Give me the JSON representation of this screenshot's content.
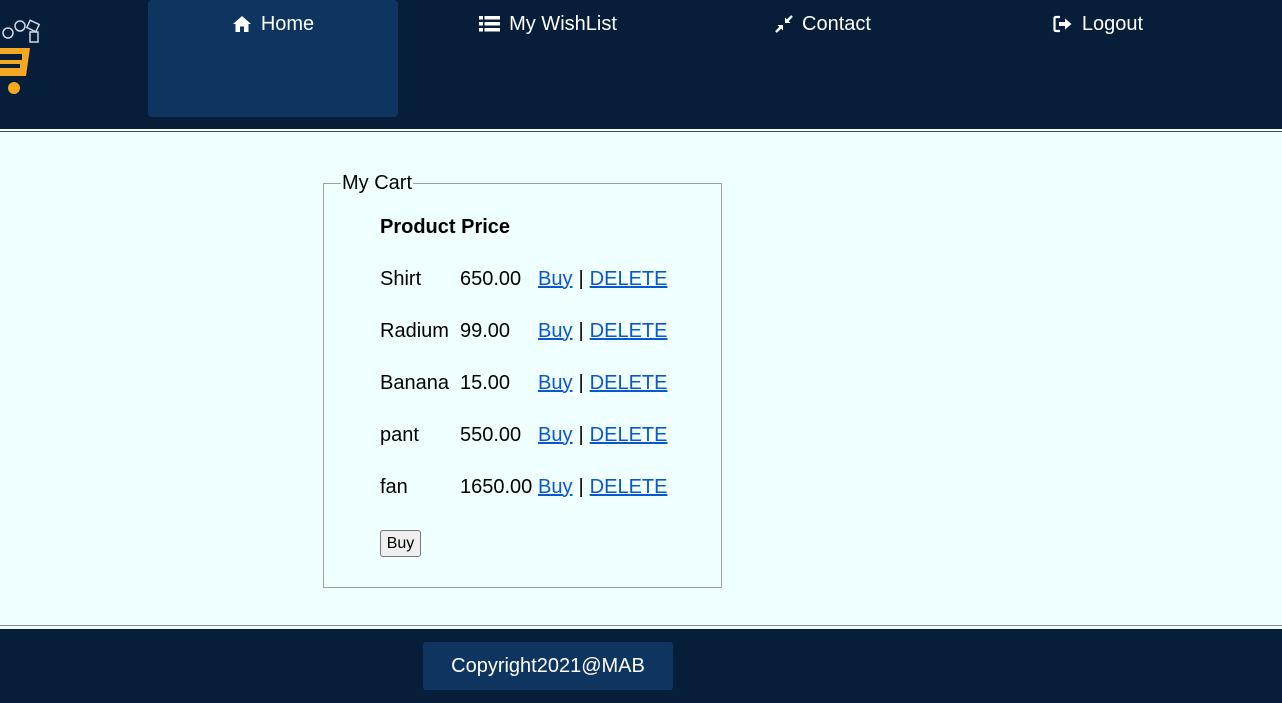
{
  "nav": {
    "home": {
      "label": "Home",
      "icon": "home-icon"
    },
    "wishlist": {
      "label": "My WishList",
      "icon": "list-icon"
    },
    "contact": {
      "label": "Contact",
      "icon": "compress-icon"
    },
    "logout": {
      "label": "Logout",
      "icon": "sign-out-icon"
    }
  },
  "cart": {
    "legend": "My Cart",
    "header": "Product Price",
    "buy_link": "Buy",
    "separator": "|",
    "delete_link": "DELETE",
    "items": [
      {
        "name": "Shirt",
        "price": "650.00"
      },
      {
        "name": "Radium",
        "price": "99.00"
      },
      {
        "name": "Banana",
        "price": "15.00"
      },
      {
        "name": "pant",
        "price": "550.00"
      },
      {
        "name": "fan",
        "price": "1650.00"
      }
    ],
    "buy_button": "Buy"
  },
  "footer": {
    "copyright": "Copyright2021@MAB"
  },
  "colors": {
    "header_bg": "#061e3a",
    "active_nav_bg": "#0e355f",
    "page_bg": "#f0ffff",
    "link": "#0b57d0",
    "logo_orange": "#f7a823"
  }
}
